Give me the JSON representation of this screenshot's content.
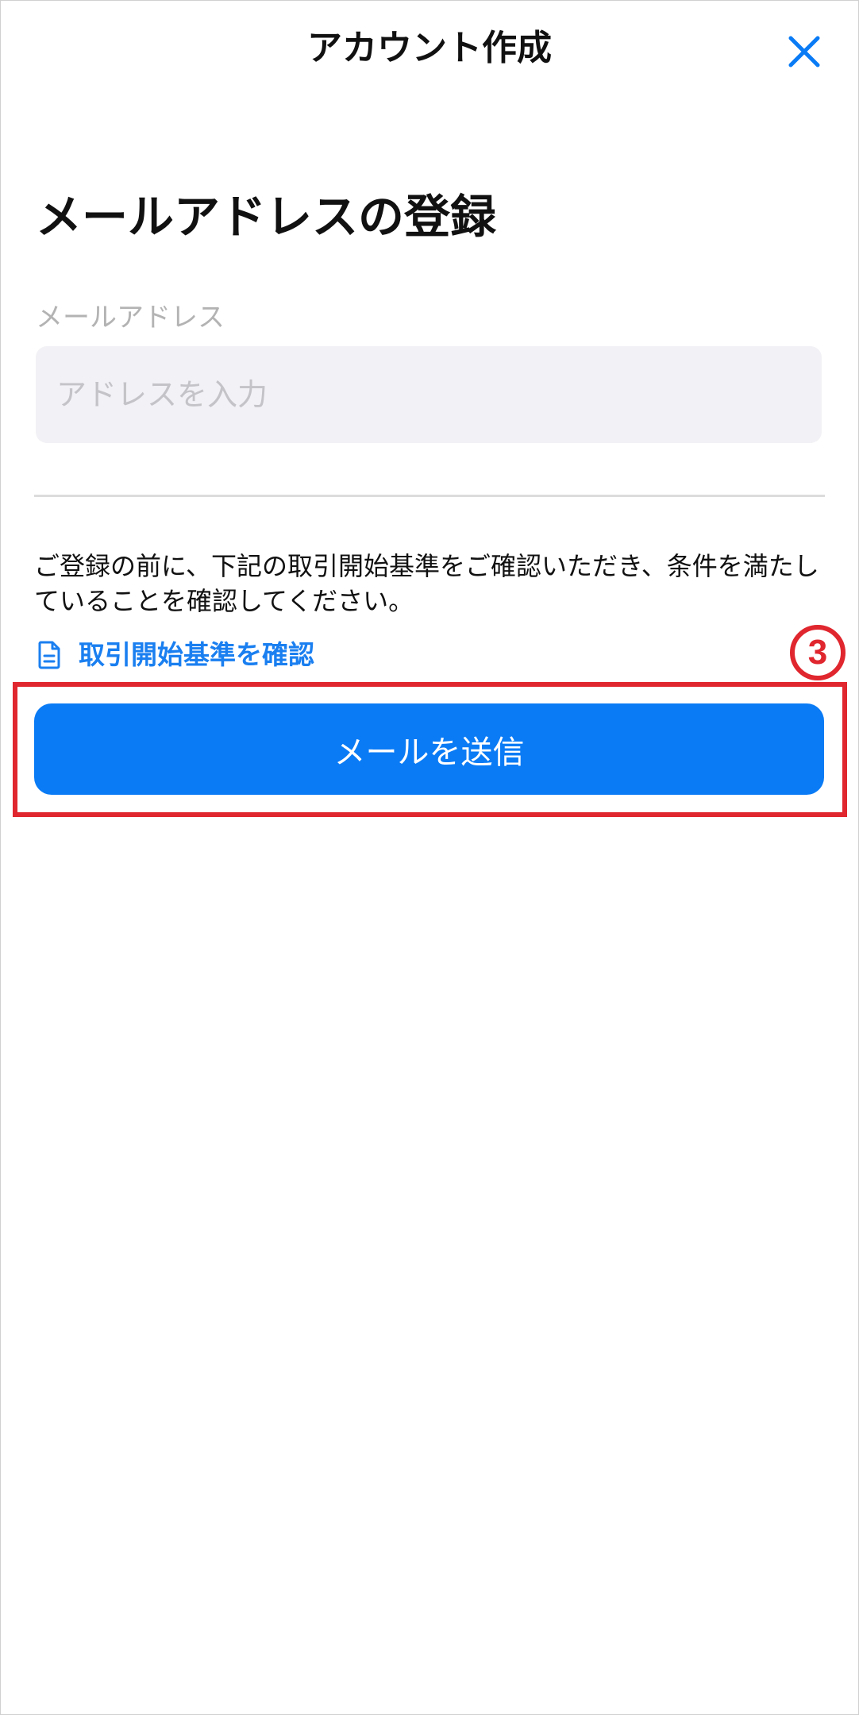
{
  "header": {
    "title": "アカウント作成",
    "close_icon": "close-icon"
  },
  "form": {
    "section_title": "メールアドレスの登録",
    "email_label": "メールアドレス",
    "email_value": "",
    "email_placeholder": "アドレスを入力"
  },
  "notice": {
    "text": "ご登録の前に、下記の取引開始基準をご確認いただき、条件を満たしていることを確認してください。",
    "link_label": "取引開始基準を確認",
    "link_icon": "document-icon"
  },
  "annotation": {
    "step_number": "3"
  },
  "actions": {
    "send_label": "メールを送信"
  },
  "colors": {
    "accent": "#0a7bf5",
    "link": "#1a7ff0",
    "annotation": "#e0262e",
    "input_background": "#f2f2f6"
  }
}
